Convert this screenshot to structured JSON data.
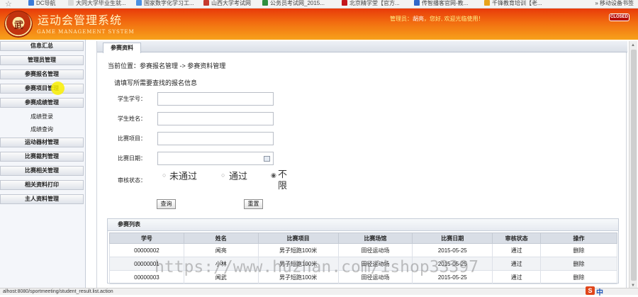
{
  "bookmarks": {
    "items": [
      {
        "label": "DC导航",
        "color": "#3b7bd8"
      },
      {
        "label": "大同大学毕业生就...",
        "color": "#d9d9d9"
      },
      {
        "label": "国家数字化学习工...",
        "color": "#4a90e2"
      },
      {
        "label": "山西大学考试网",
        "color": "#c63a2e"
      },
      {
        "label": "公务员考试网_2015...",
        "color": "#2f8f3e"
      },
      {
        "label": "北京精学堂【官方...",
        "color": "#c4161c"
      },
      {
        "label": "传智播客官网-教...",
        "color": "#3067c9"
      },
      {
        "label": "千锋教育培训【老...",
        "color": "#e8a31b"
      }
    ],
    "more": "» 移动设备书签"
  },
  "header": {
    "title": "运动会管理系统",
    "subtitle": "GAME MANAGEMENT SYSTEM",
    "welcome_prefix": "管理员：",
    "welcome_user": "胡亮",
    "welcome_suffix": "，您好, 欢迎光临使用！",
    "closed_label": "CLOSED",
    "logo_glyph": "武"
  },
  "sidebar": {
    "items": [
      {
        "label": "信息汇总"
      },
      {
        "label": "管理员管理"
      },
      {
        "label": "参赛报名管理"
      },
      {
        "label": "参赛项目管理"
      },
      {
        "label": "参赛成绩管理"
      }
    ],
    "subitems": [
      {
        "label": "成绩登录"
      },
      {
        "label": "成绩查询"
      }
    ],
    "items2": [
      {
        "label": "运动器材管理"
      },
      {
        "label": "比赛裁判管理"
      },
      {
        "label": "比赛相关管理"
      },
      {
        "label": "相关资料打印"
      },
      {
        "label": "主人资料管理"
      }
    ]
  },
  "content": {
    "tab_label": "参赛资料",
    "breadcrumb": "当前位置：参赛报名管理 -> 参赛资料管理",
    "hint": "请填写所需要查找的报名信息",
    "fields": {
      "student_no": {
        "label": "学生学号：",
        "value": ""
      },
      "student_name": {
        "label": "学生姓名：",
        "value": ""
      },
      "event": {
        "label": "比赛项目：",
        "value": ""
      },
      "date": {
        "label": "比赛日期：",
        "value": ""
      }
    },
    "review": {
      "label": "审核状态：",
      "options": [
        "未通过",
        "通过",
        "不限"
      ],
      "selected": "不限"
    },
    "query_button": "查询",
    "reset_button": "重置",
    "table": {
      "title": "参赛列表",
      "headers": [
        "学号",
        "姓名",
        "比赛项目",
        "比赛场馆",
        "比赛日期",
        "审核状态",
        "操作"
      ],
      "rows": [
        [
          "00000002",
          "闻亮",
          "男子短跑100米",
          "田径运动场",
          "2015-05-25",
          "通过",
          "删除"
        ],
        [
          "00000001",
          "小林",
          "男子短跑100米",
          "田径运动场",
          "2015-05-25",
          "通过",
          "删除"
        ],
        [
          "00000003",
          "闻武",
          "男子短跑100米",
          "田径运动场",
          "2015-05-25",
          "通过",
          "删除"
        ]
      ]
    }
  },
  "watermark": "https://www.huzhan.com/ishop33397",
  "status_url": "alhost:8080/sportmeeting/student_result.list.action",
  "tray_label": "中"
}
